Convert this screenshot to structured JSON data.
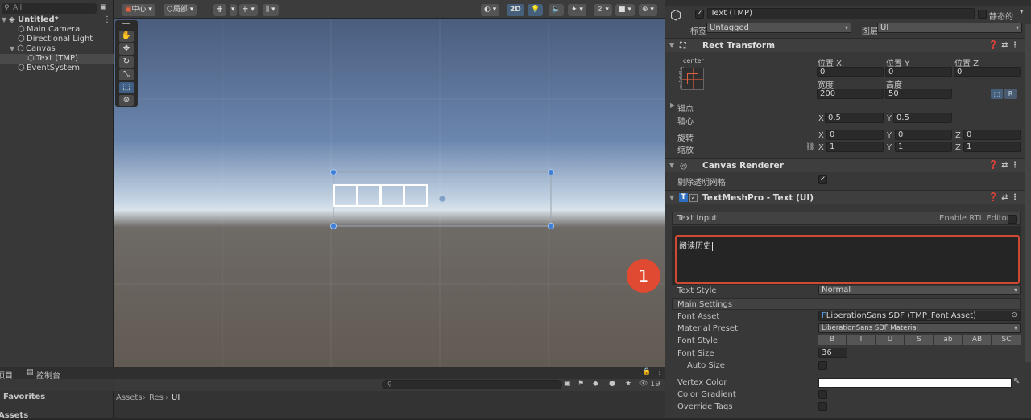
{
  "hierarchy": {
    "search_placeholder": "All",
    "items": [
      {
        "label": "Untitled*",
        "level": 0
      },
      {
        "label": "Main Camera",
        "level": 1
      },
      {
        "label": "Directional Light",
        "level": 1
      },
      {
        "label": "Canvas",
        "level": 1
      },
      {
        "label": "Text (TMP)",
        "level": 2
      },
      {
        "label": "EventSystem",
        "level": 1
      }
    ]
  },
  "scene_toolbar": {
    "pivot_label": "中心",
    "space_label": "局部",
    "mode_2d": "2D"
  },
  "inspector": {
    "object_name": "Text (TMP)",
    "static_label": "静态的",
    "tag_label": "标签",
    "tag_value": "Untagged",
    "layer_label": "图层",
    "layer_value": "UI",
    "rect_transform": {
      "title": "Rect Transform",
      "anchor_preset_top": "center",
      "anchor_preset_side": "middle",
      "pos_x_label": "位置 X",
      "pos_y_label": "位置 Y",
      "pos_z_label": "位置 Z",
      "pos_x": "0",
      "pos_y": "0",
      "pos_z": "0",
      "width_label": "宽度",
      "height_label": "高度",
      "width": "200",
      "height": "50",
      "r_button": "R",
      "anchors_label": "锚点",
      "pivot_label": "轴心",
      "pivot_x": "0.5",
      "pivot_y": "0.5",
      "rotation_label": "旋转",
      "rot_x": "0",
      "rot_y": "0",
      "rot_z": "0",
      "scale_label": "缩放",
      "scale_x": "1",
      "scale_y": "1",
      "scale_z": "1"
    },
    "canvas_renderer": {
      "title": "Canvas Renderer",
      "cull_label": "剔除透明网格"
    },
    "tmp": {
      "title": "TextMeshPro - Text (UI)",
      "text_input_label": "Text Input",
      "rtl_label": "Enable RTL Editor",
      "text_value": "阅读历史",
      "text_style_label": "Text Style",
      "text_style_value": "Normal",
      "main_settings_label": "Main Settings",
      "font_asset_label": "Font Asset",
      "font_asset_value": "LiberationSans SDF (TMP_Font Asset)",
      "material_preset_label": "Material Preset",
      "material_preset_value": "LiberationSans SDF Material",
      "font_style_label": "Font Style",
      "font_style_buttons": [
        "B",
        "I",
        "U",
        "S",
        "ab",
        "AB",
        "SC"
      ],
      "font_size_label": "Font Size",
      "font_size_value": "36",
      "auto_size_label": "Auto Size",
      "vertex_color_label": "Vertex Color",
      "color_gradient_label": "Color Gradient",
      "override_tags_label": "Override Tags"
    }
  },
  "annotation_badge": "1",
  "bottom": {
    "project_tab": "项目",
    "console_tab": "控制台",
    "favorites_label": "Favorites",
    "assets_label": "Assets",
    "breadcrumb": [
      "Assets",
      "Res",
      "UI"
    ],
    "hidden_count": "19"
  },
  "colors": {
    "accent": "#3f5f85",
    "annotation_red": "#e04a33",
    "panel": "#383838"
  }
}
